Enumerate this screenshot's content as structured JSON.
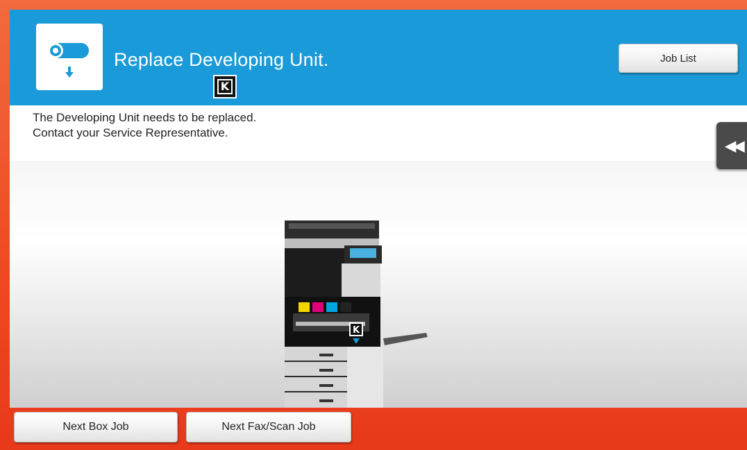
{
  "header": {
    "title": "Replace Developing Unit.",
    "color_badge": "K",
    "job_list_label": "Job List",
    "icon": "developing-unit-replace-icon",
    "color": "#1a9ad8"
  },
  "message": {
    "line1": "The Developing Unit needs to be replaced.",
    "line2": "Contact your Service Representative."
  },
  "side_panel": {
    "icon": "double-chevron-left-icon",
    "label": "◀◀"
  },
  "illustration": {
    "name": "printer-illustration",
    "badge": "K"
  },
  "footer": {
    "next_box_job_label": "Next Box Job",
    "next_fax_scan_job_label": "Next Fax/Scan Job"
  },
  "colors": {
    "frame": "#ee4a22",
    "header": "#1a9ad8"
  }
}
